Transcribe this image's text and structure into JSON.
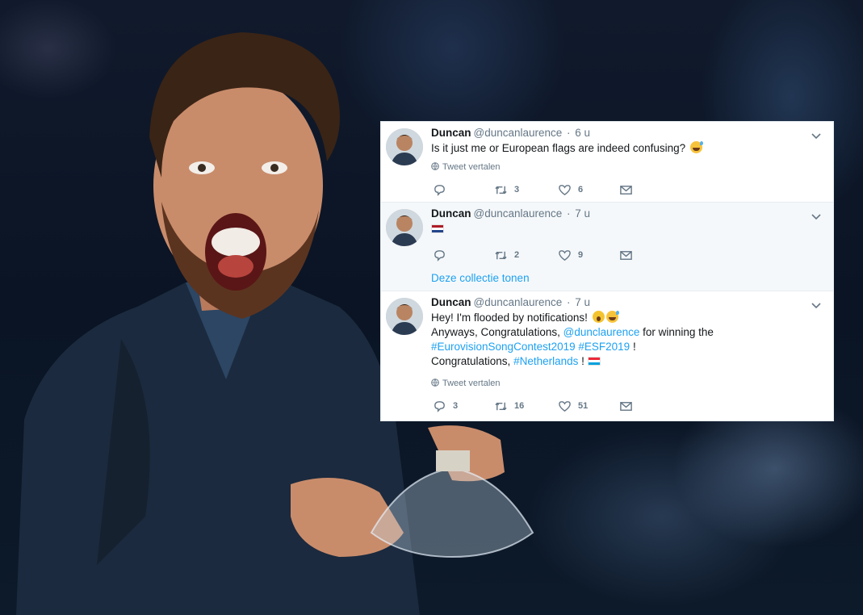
{
  "tweets": [
    {
      "name": "Duncan",
      "handle": "@duncanlaurence",
      "time": "6 u",
      "text": "Is it just me or European flags are indeed confusing?",
      "translate": "Tweet vertalen",
      "reply_count": "",
      "retweet_count": "3",
      "like_count": "6"
    },
    {
      "name": "Duncan",
      "handle": "@duncanlaurence",
      "time": "7 u",
      "reply_count": "",
      "retweet_count": "2",
      "like_count": "9",
      "show_collection": "Deze collectie tonen"
    },
    {
      "name": "Duncan",
      "handle": "@duncanlaurence",
      "time": "7 u",
      "line1": "Hey! I'm flooded by notifications!",
      "line2_pre": "Anyways, Congratulations,",
      "mention": "@dunclaurence",
      "line2_post": "for winning the",
      "hashtag1": "#EurovisionSongContest2019",
      "hashtag2": "#ESF2019",
      "line3_post": "!",
      "line4_pre": "Congratulations,",
      "hashtag3": "#Netherlands",
      "line4_post": "!",
      "translate": "Tweet vertalen",
      "reply_count": "3",
      "retweet_count": "16",
      "like_count": "51"
    }
  ],
  "icons": [
    "reply-icon",
    "retweet-icon",
    "like-icon",
    "direct-message-icon",
    "chevron-down-icon",
    "globe-icon"
  ],
  "colors": {
    "link": "#1da1f2",
    "muted": "#657786",
    "text": "#14171a"
  }
}
